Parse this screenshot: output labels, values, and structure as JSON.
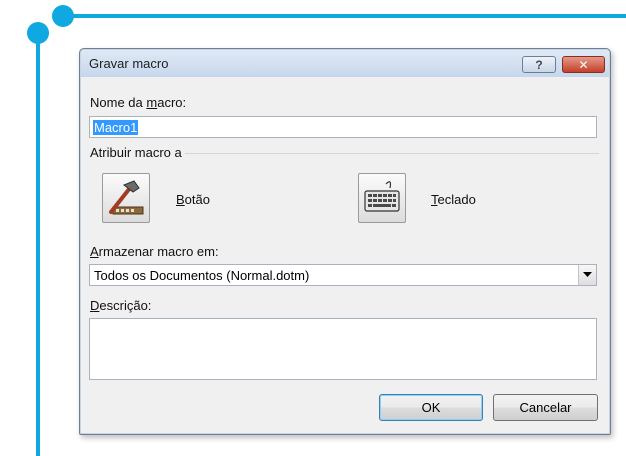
{
  "dialog": {
    "title": "Gravar macro",
    "help_glyph": "?",
    "close_glyph": "✕",
    "name_label_pre": "Nome da ",
    "name_label_u": "m",
    "name_label_post": "acro:",
    "name_value": "Macro1",
    "assign_label": "Atribuir macro a",
    "button_label_u": "B",
    "button_label_post": "otão",
    "keyboard_label_u": "T",
    "keyboard_label_post": "eclado",
    "store_label_u": "A",
    "store_label_post": "rmazenar macro em:",
    "store_value": "Todos os Documentos (Normal.dotm)",
    "description_label_u": "D",
    "description_label_post": "escrição:",
    "description_value": "",
    "ok_label": "OK",
    "cancel_label": "Cancelar"
  },
  "icons": [
    "help-icon",
    "close-icon",
    "hammer-icon",
    "keyboard-icon",
    "dropdown-arrow-icon"
  ],
  "colors": {
    "accent_decoration": "#10a8e0",
    "selection": "#3399ff",
    "close_button": "#c4402a",
    "titlebar": "#c6d7ec"
  }
}
